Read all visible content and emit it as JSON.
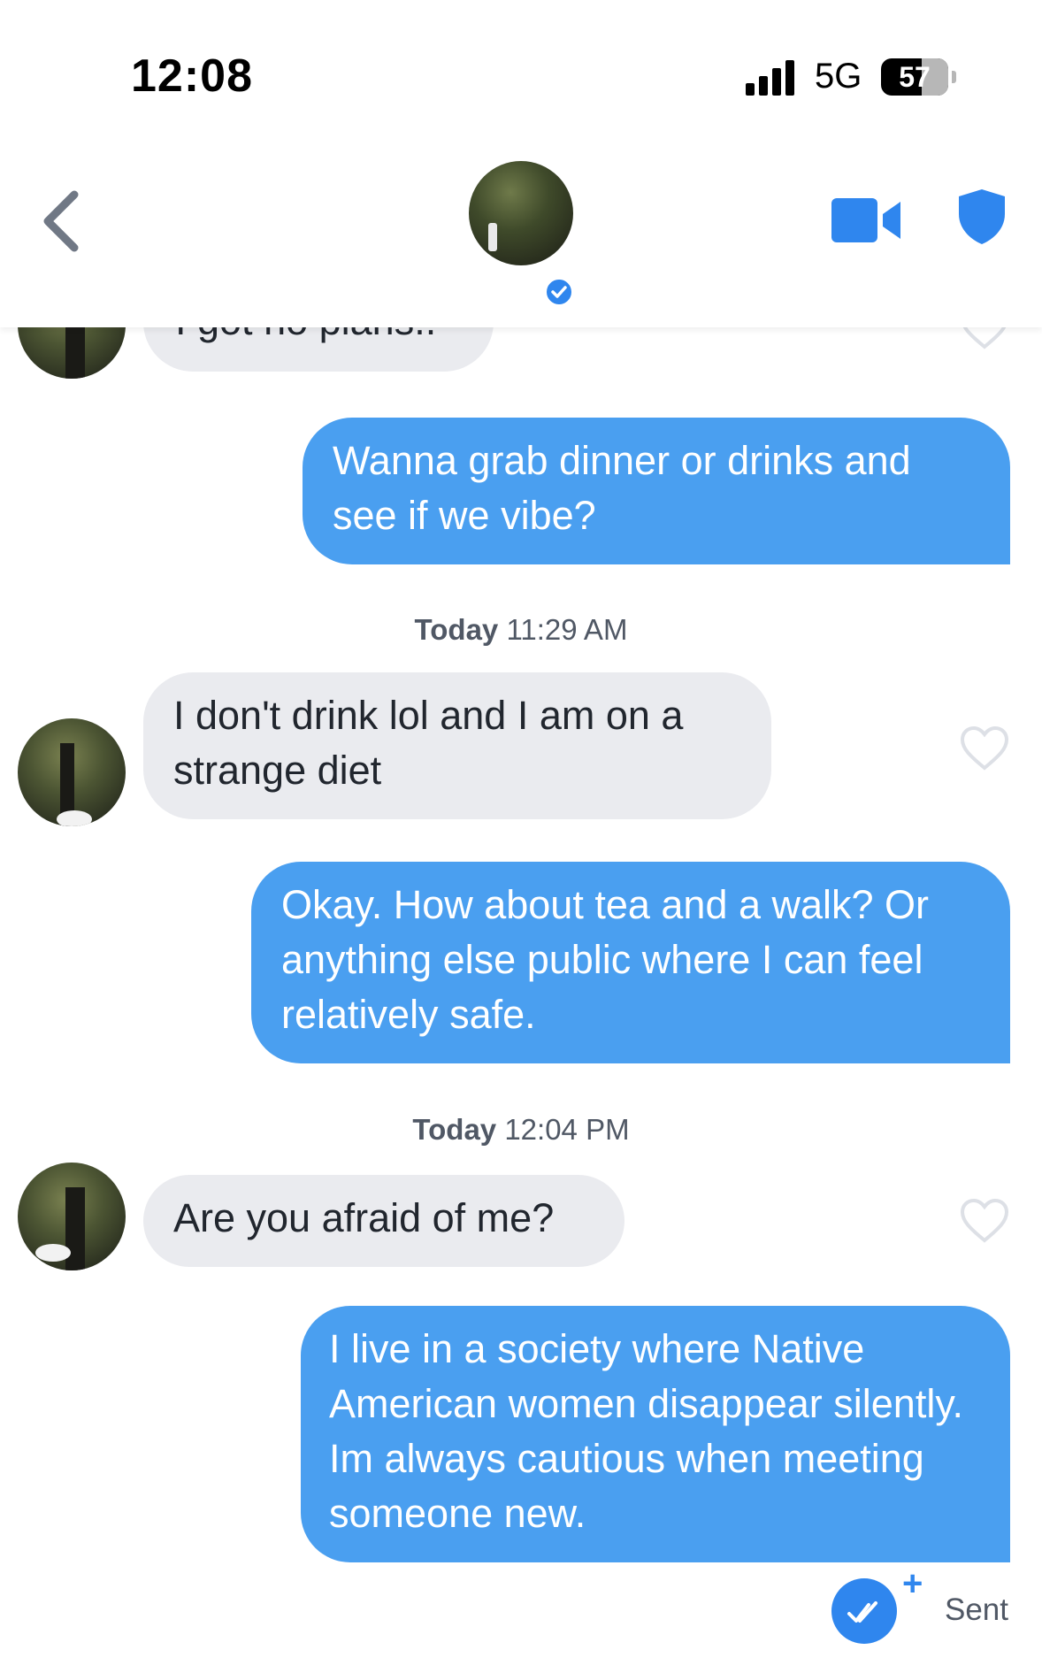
{
  "status_bar": {
    "time": "12:08",
    "network": "5G",
    "battery": "57"
  },
  "header": {
    "icons": {
      "back": "chevron-left-icon",
      "video": "video-camera-icon",
      "safety": "shield-icon",
      "verified": "verified-check-icon"
    }
  },
  "messages": [
    {
      "side": "in",
      "text": "I got no plans.."
    },
    {
      "side": "out",
      "text": "Wanna grab dinner or drinks and see if we vibe?"
    },
    {
      "side": "in",
      "text": "I don't drink lol and I am on a strange diet"
    },
    {
      "side": "out",
      "text": "Okay. How about tea and a walk? Or anything else public where I can feel relatively safe."
    },
    {
      "side": "in",
      "text": "Are you afraid of me?"
    },
    {
      "side": "out",
      "text": "I live in a society where Native American women disappear silently. Im always cautious when meeting someone new."
    }
  ],
  "timestamps": [
    {
      "day": "Today",
      "time": "11:29 AM"
    },
    {
      "day": "Today",
      "time": "12:04 PM"
    }
  ],
  "receipt": {
    "label": "Sent",
    "plus": "+"
  },
  "colors": {
    "outgoing_bubble": "#4a9ff0",
    "incoming_bubble": "#eaebef",
    "accent": "#2f86ee"
  }
}
